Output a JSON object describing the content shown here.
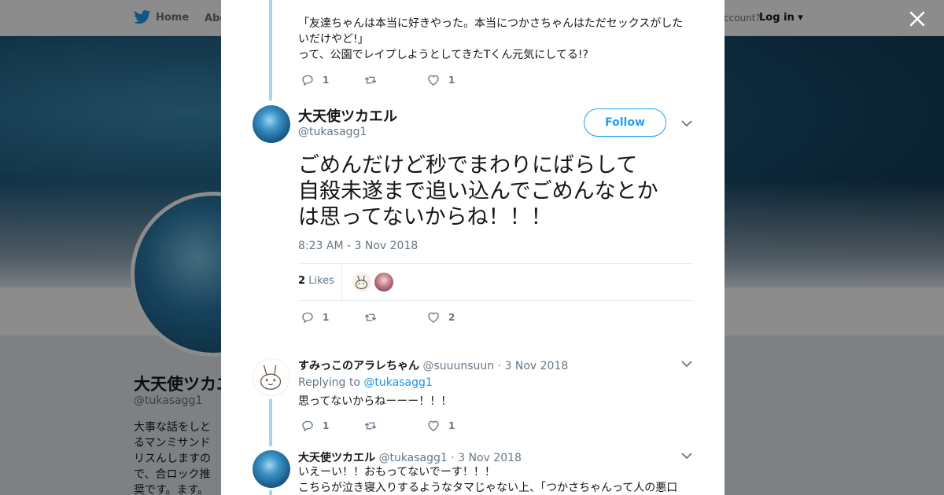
{
  "background": {
    "nav_home": "Home",
    "nav_about": "Abo",
    "nav_account": "ccount?",
    "nav_login": "Log in",
    "profile_name": "大天使ツカエ",
    "profile_handle": "@tukasagg1",
    "profile_bio": "大事な話をしとるマンミサンドリスんしますので、合ロック推奨です。ます。"
  },
  "modal": {
    "previous_tweet": {
      "text_line1": "「友達ちゃんは本当に好きやった。本当につかさちゃんはただセックスがした",
      "text_line2": "いだけやど!」",
      "text_line3": "って、公園でレイプしようとしてきたTくん元気にしてる!?",
      "reply_count": "1",
      "retweet_count": "",
      "like_count": "1"
    },
    "main_tweet": {
      "author_name": "大天使ツカエル",
      "author_handle": "@tukasagg1",
      "follow_label": "Follow",
      "text_line1": "ごめんだけど秒でまわりにばらして",
      "text_line2": "自殺未遂まで追い込んでごめんなとか",
      "text_line3": "は思ってないからね！！！",
      "timestamp": "8:23 AM - 3 Nov 2018",
      "likes_number": "2",
      "likes_label": "Likes",
      "reply_count": "1",
      "retweet_count": "",
      "like_count": "2"
    },
    "reply1": {
      "author_name": "すみっこのアラレちゃん",
      "author_handle": "@suuunsuun",
      "date": "· 3 Nov 2018",
      "replying_to_label": "Replying to",
      "replying_to_handle": "@tukasagg1",
      "text": "思ってないからねーーー！！！",
      "reply_count": "1",
      "retweet_count": "",
      "like_count": "1"
    },
    "reply2": {
      "author_name": "大天使ツカエル",
      "author_handle": "@tukasagg1",
      "date": "· 3 Nov 2018",
      "text_line1": "いえーい！！おもってないでーす！！！",
      "text_line2": "こちらが泣き寝入りするようなタマじゃない上、「つかさちゃんって人の悪口"
    }
  },
  "colors": {
    "twitter_blue": "#1da1f2",
    "text_primary": "#14171a",
    "text_secondary": "#657786",
    "thread_line": "#a6d4f2"
  }
}
